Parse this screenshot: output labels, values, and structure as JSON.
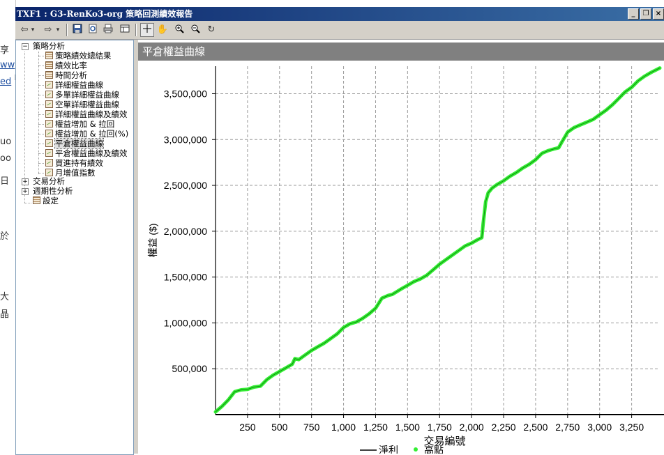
{
  "window": {
    "title": "TXF1 : G3-RenKo3-org 策略回測績效報告",
    "controls": [
      "minimize",
      "restore",
      "close"
    ]
  },
  "background_fragments": [
    "享",
    "ww",
    "ed",
    "uo",
    "oo",
    "日",
    "於",
    "大",
    "晶"
  ],
  "toolbar": {
    "buttons": [
      "back-icon",
      "back-dropdown-icon",
      "forward-icon",
      "forward-dropdown-icon",
      "save-icon",
      "preview-icon",
      "print-icon",
      "table-icon",
      "crosshair-icon",
      "hand-icon",
      "zoom-in-icon",
      "zoom-out-icon",
      "refresh-icon"
    ]
  },
  "tree": {
    "root1": {
      "label": "策略分析",
      "expanded": true
    },
    "items": [
      {
        "label": "策略績效總結果",
        "icon": "grid"
      },
      {
        "label": "績效比率",
        "icon": "grid"
      },
      {
        "label": "時間分析",
        "icon": "grid"
      },
      {
        "label": "詳細權益曲線",
        "icon": "chart"
      },
      {
        "label": "多單詳細權益曲線",
        "icon": "chart"
      },
      {
        "label": "空單詳細權益曲線",
        "icon": "chart"
      },
      {
        "label": "詳細權益曲線及績效",
        "icon": "chart"
      },
      {
        "label": "權益增加 & 拉回",
        "icon": "chart"
      },
      {
        "label": "權益增加 & 拉回(%)",
        "icon": "chart"
      },
      {
        "label": "平倉權益曲線",
        "icon": "chart",
        "selected": true
      },
      {
        "label": "平倉權益曲線及績效",
        "icon": "chart"
      },
      {
        "label": "買進持有績效",
        "icon": "chart"
      },
      {
        "label": "月增值指數",
        "icon": "chart"
      }
    ],
    "root2": {
      "label": "交易分析",
      "expanded": false
    },
    "root3": {
      "label": "週期性分析",
      "expanded": false
    },
    "root4": {
      "label": "設定"
    }
  },
  "panel": {
    "title": "平倉權益曲線"
  },
  "chart_data": {
    "type": "line",
    "xlabel": "交易編號",
    "ylabel": "權益 ($)",
    "xlim": [
      0,
      3470
    ],
    "ylim": [
      0,
      3800000
    ],
    "xticks": [
      250,
      500,
      750,
      1000,
      1250,
      1500,
      1750,
      2000,
      2250,
      2500,
      2750,
      3000,
      3250
    ],
    "xtick_labels": [
      "250",
      "500",
      "750",
      "1,000",
      "1,250",
      "1,500",
      "1,750",
      "2,000",
      "2,250",
      "2,500",
      "2,750",
      "3,000",
      "3,250"
    ],
    "yticks": [
      500000,
      1000000,
      1500000,
      2000000,
      2500000,
      3000000,
      3500000
    ],
    "ytick_labels": [
      "500,000",
      "1,000,000",
      "1,500,000",
      "2,000,000",
      "2,500,000",
      "3,000,000",
      "3,500,000"
    ],
    "grid": true,
    "legend": [
      "淨利",
      "高點"
    ],
    "series": [
      {
        "name": "淨利",
        "color": "#000000",
        "x": [
          0,
          50,
          100,
          150,
          200,
          250,
          300,
          350,
          400,
          450,
          500,
          550,
          600,
          620,
          650,
          700,
          750,
          800,
          850,
          900,
          950,
          1000,
          1050,
          1100,
          1150,
          1200,
          1250,
          1300,
          1350,
          1380,
          1450,
          1500,
          1550,
          1600,
          1650,
          1700,
          1750,
          1800,
          1850,
          1900,
          1950,
          2000,
          2050,
          2080,
          2090,
          2100,
          2110,
          2130,
          2160,
          2200,
          2250,
          2300,
          2350,
          2400,
          2450,
          2500,
          2550,
          2600,
          2650,
          2680,
          2700,
          2750,
          2800,
          2850,
          2900,
          2950,
          3000,
          3050,
          3100,
          3150,
          3200,
          3250,
          3300,
          3350,
          3400,
          3470
        ],
        "y": [
          30000,
          90000,
          160000,
          250000,
          270000,
          275000,
          300000,
          310000,
          380000,
          430000,
          470000,
          510000,
          550000,
          610000,
          600000,
          650000,
          700000,
          740000,
          780000,
          830000,
          880000,
          950000,
          990000,
          1010000,
          1050000,
          1100000,
          1160000,
          1270000,
          1300000,
          1310000,
          1370000,
          1410000,
          1450000,
          1480000,
          1520000,
          1580000,
          1640000,
          1690000,
          1740000,
          1790000,
          1840000,
          1870000,
          1910000,
          1930000,
          2080000,
          2200000,
          2320000,
          2420000,
          2470000,
          2510000,
          2550000,
          2600000,
          2640000,
          2690000,
          2730000,
          2780000,
          2850000,
          2880000,
          2900000,
          2910000,
          2960000,
          3080000,
          3130000,
          3160000,
          3190000,
          3220000,
          3270000,
          3320000,
          3380000,
          3450000,
          3520000,
          3570000,
          3640000,
          3690000,
          3730000,
          3780000
        ]
      },
      {
        "name": "高點",
        "color": "#33ee33",
        "marker": "dot",
        "same_as_equity": true
      }
    ]
  }
}
